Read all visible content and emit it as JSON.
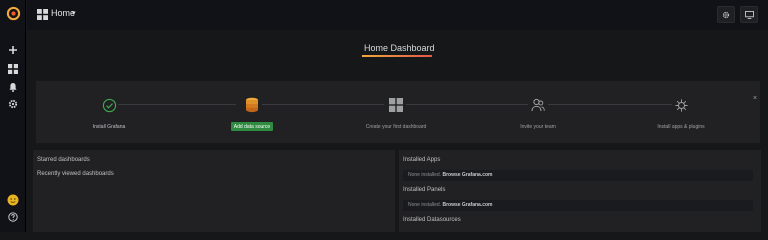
{
  "topbar": {
    "dashboard_name": "Home",
    "caret": "▾"
  },
  "title": "Home Dashboard",
  "getting_started": {
    "close_glyph": "×",
    "steps": [
      {
        "label": "Install Grafana",
        "icon": "check-circle-icon",
        "status": "done"
      },
      {
        "label": "Add data source",
        "icon": "database-icon",
        "status": "active"
      },
      {
        "label": "Create your first dashboard",
        "icon": "dashboard-grid-icon",
        "status": "todo"
      },
      {
        "label": "Invite your team",
        "icon": "users-icon",
        "status": "todo"
      },
      {
        "label": "Install apps & plugins",
        "icon": "cubes-icon",
        "status": "todo"
      }
    ]
  },
  "left_panel": {
    "starred": "Starred dashboards",
    "recent": "Recently viewed dashboards"
  },
  "right_panel": {
    "apps_header": "Installed Apps",
    "apps_none": "None installed.",
    "apps_link": "Browse Grafana.com",
    "panels_header": "Installed Panels",
    "panels_none": "None installed.",
    "panels_link": "Browse Grafana.com",
    "datasources_header": "Installed Datasources"
  },
  "colors": {
    "accent_orange": "#f2a93b",
    "success_green": "#2e8b3f",
    "background": "#161719",
    "panel": "#212124"
  }
}
